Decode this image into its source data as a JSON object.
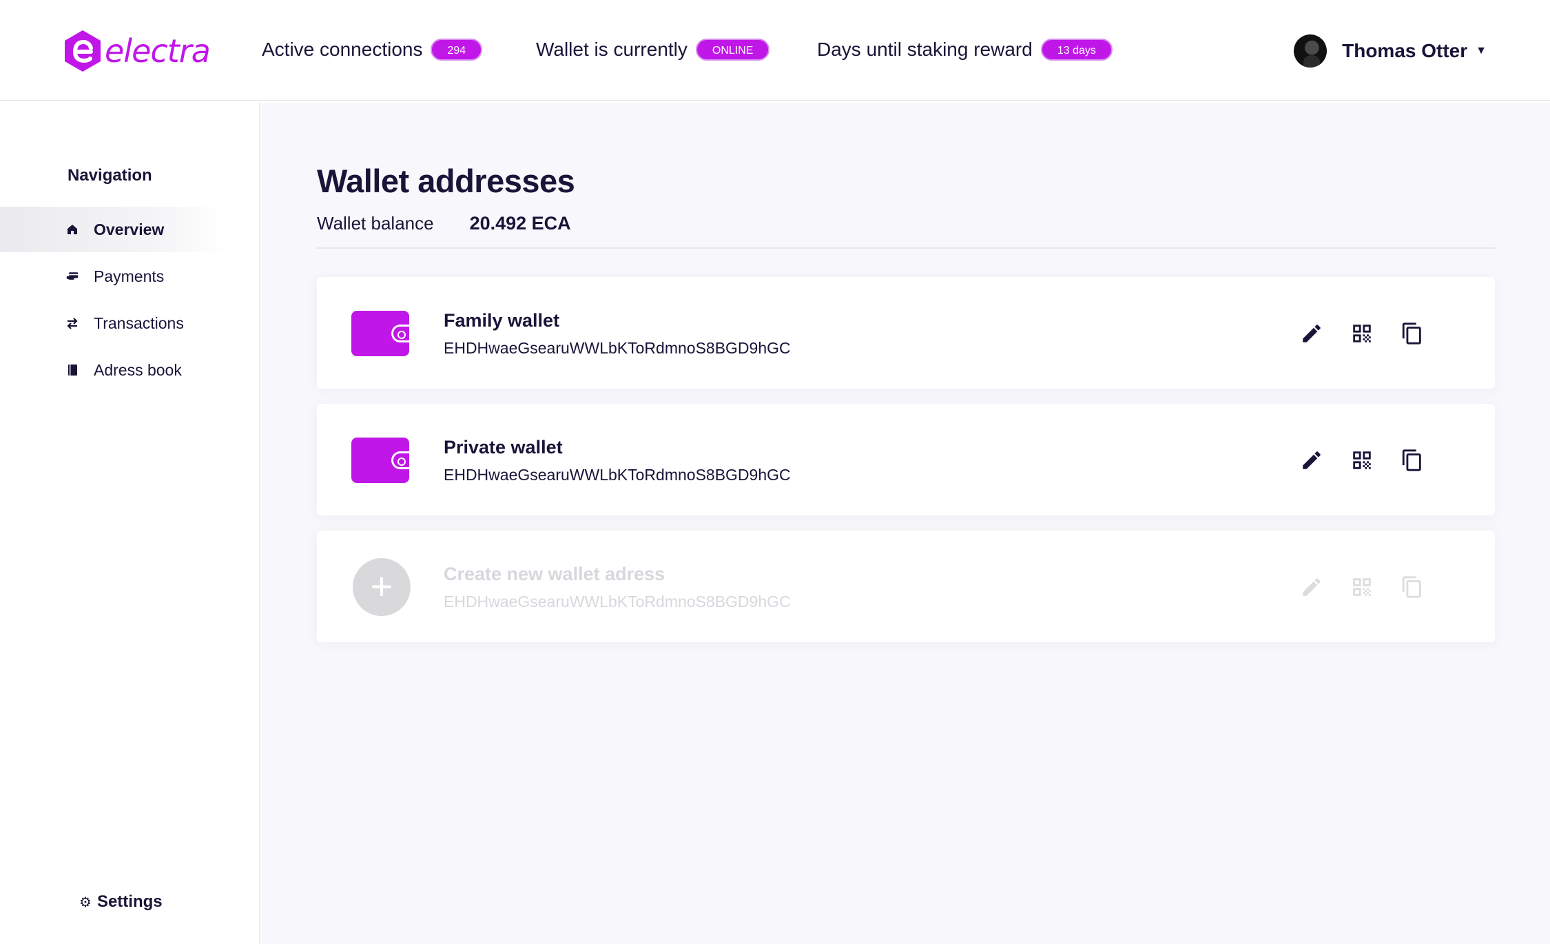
{
  "header": {
    "brand": "electra",
    "stats": [
      {
        "label": "Active connections",
        "badge": "294"
      },
      {
        "label": "Wallet is currently",
        "badge": "ONLINE"
      },
      {
        "label": "Days until staking reward",
        "badge": "13 days"
      }
    ],
    "user_name": "Thomas Otter"
  },
  "sidebar": {
    "title": "Navigation",
    "items": [
      {
        "label": "Overview",
        "icon": "home-icon"
      },
      {
        "label": "Payments",
        "icon": "payment-icon"
      },
      {
        "label": "Transactions",
        "icon": "swap-icon"
      },
      {
        "label": "Adress book",
        "icon": "book-icon"
      }
    ],
    "settings_label": "Settings"
  },
  "main": {
    "title": "Wallet addresses",
    "balance_label": "Wallet balance",
    "balance_value": "20.492 ECA",
    "wallets": [
      {
        "name": "Family wallet",
        "address": "EHDHwaeGsearuWWLbKToRdmnoS8BGD9hGC"
      },
      {
        "name": "Private wallet",
        "address": "EHDHwaeGsearuWWLbKToRdmnoS8BGD9hGC"
      },
      {
        "name": "Create new wallet adress",
        "address": "EHDHwaeGsearuWWLbKToRdmnoS8BGD9hGC"
      }
    ]
  },
  "colors": {
    "accent": "#c116e8",
    "text": "#1b1338",
    "muted": "#d7d7dd"
  }
}
